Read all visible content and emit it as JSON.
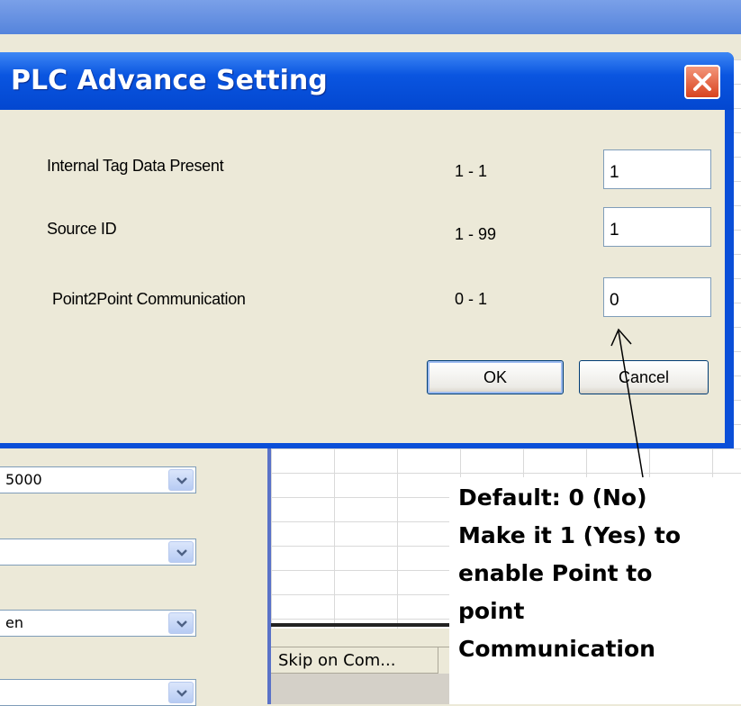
{
  "background": {
    "combos": [
      {
        "text": "5000"
      },
      {
        "text": ""
      },
      {
        "text": "en"
      },
      {
        "text": ""
      }
    ],
    "grid_column_header": "Skip on Com..."
  },
  "dialog": {
    "title": "PLC Advance Setting",
    "fields": [
      {
        "label": "Internal Tag Data Present",
        "range": "1 - 1",
        "value": "1"
      },
      {
        "label": "Source ID",
        "range": "1 - 99",
        "value": "1"
      },
      {
        "label": "Point2Point Communication",
        "range": "0 - 1",
        "value": "0"
      }
    ],
    "ok_label": "OK",
    "cancel_label": "Cancel"
  },
  "annotation": {
    "lines": [
      "Default: 0  (No)",
      "Make it 1 (Yes) to",
      "enable Point to",
      "point",
      "Communication"
    ]
  },
  "colors": {
    "title_bar": "#0a55e0",
    "dialog_body": "#ece9d8",
    "close_button": "#d8431f"
  }
}
